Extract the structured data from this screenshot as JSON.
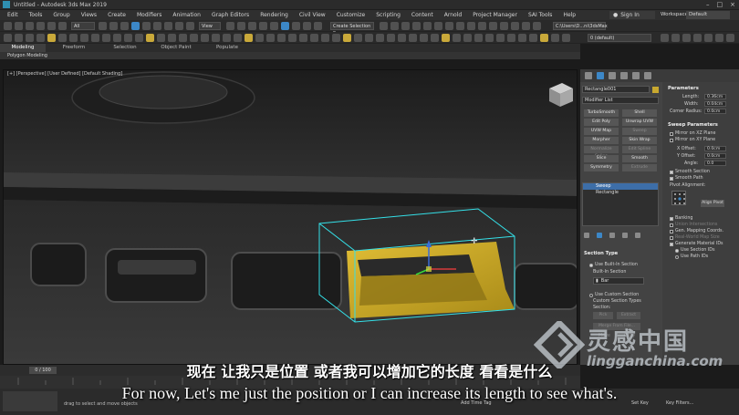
{
  "window": {
    "title": "Untitled - Autodesk 3ds Max 2019"
  },
  "menu": {
    "items": [
      "Edit",
      "Tools",
      "Group",
      "Views",
      "Create",
      "Modifiers",
      "Animation",
      "Graph Editors",
      "Rendering",
      "Civil View",
      "Customize",
      "Scripting",
      "Content",
      "Arnold",
      "Project Manager",
      "SAI Tools",
      "Help"
    ],
    "signin": "Sign In",
    "workspaces_label": "Workspaces:",
    "workspaces_value": "Default"
  },
  "toolbar": {
    "filter": "All",
    "view": "View",
    "selection_set": "Create Selection Se",
    "path": "C:\\Users\\D...ni\\3dsMax",
    "layer": "0 (default)"
  },
  "ribbon": {
    "tabs": [
      "Modeling",
      "Freeform",
      "Selection",
      "Object Paint",
      "Populate"
    ],
    "active": "Modeling",
    "subtitle": "Polygon Modeling"
  },
  "viewport": {
    "label": "[+] [Perspective] [User Defined] [Default Shading]"
  },
  "command_panel": {
    "object_name": "Rectangle001",
    "modifier_list": "Modifier List",
    "modifier_buttons": [
      {
        "label": "TurboSmooth",
        "dim": false
      },
      {
        "label": "Shell",
        "dim": false
      },
      {
        "label": "Edit Poly",
        "dim": false
      },
      {
        "label": "Unwrap UVW",
        "dim": false
      },
      {
        "label": "UVW Map",
        "dim": false
      },
      {
        "label": "Sweep",
        "dim": true
      },
      {
        "label": "Morpher",
        "dim": false
      },
      {
        "label": "Skin Wrap",
        "dim": false
      },
      {
        "label": "Normalize Spline",
        "dim": true
      },
      {
        "label": "Edit Spline",
        "dim": true
      },
      {
        "label": "Slice",
        "dim": false
      },
      {
        "label": "Smooth",
        "dim": false
      },
      {
        "label": "Symmetry",
        "dim": false
      },
      {
        "label": "Extrude",
        "dim": true
      }
    ],
    "stack": [
      "Sweep",
      "Rectangle"
    ],
    "section_type": {
      "header": "Section Type",
      "use_builtin": "Use Built-In Section",
      "builtin_label": "Built-In Section",
      "builtin_value": "Bar",
      "use_custom": "Use Custom Section",
      "custom_types": "Custom Section Types",
      "section_label": "Section:",
      "pick": "Pick",
      "extract": "Extract",
      "merge": "Merge From File...",
      "move": "Move",
      "copy": "Copy"
    },
    "parameters": {
      "header": "Parameters",
      "length_label": "Length:",
      "length_value": "0.36cm",
      "width_label": "Width:",
      "width_value": "0.04cm",
      "corner_label": "Corner Radius:",
      "corner_value": "0.0cm"
    },
    "sweep_params": {
      "header": "Sweep Parameters",
      "mirror_xz": "Mirror on XZ Plane",
      "mirror_xy": "Mirror on XY Plane",
      "xoffset_label": "X Offset:",
      "xoffset_value": "0.0cm",
      "yoffset_label": "Y Offset:",
      "yoffset_value": "0.0cm",
      "angle_label": "Angle:",
      "angle_value": "0.0",
      "smooth_section": "Smooth Section",
      "smooth_path": "Smooth Path",
      "pivot_alignment": "Pivot Alignment:",
      "align_pivot": "Align Pivot",
      "banking": "Banking",
      "union": "Union Intersections",
      "gen_mapping": "Gen. Mapping Coords.",
      "real_world": "Real-World Map Size",
      "gen_material": "Generate Material IDs",
      "use_section_ids": "Use Section IDs",
      "use_path_ids": "Use Path IDs"
    }
  },
  "timeline": {
    "frame": "0 / 100"
  },
  "status": {
    "prompt": "drag to select and move objects",
    "add_time_tag": "Add Time Tag",
    "set_key": "Set Key",
    "key_filters": "Key Filters..."
  },
  "subtitles": {
    "cn": "现在 让我只是位置 或者我可以增加它的长度 看看是什么",
    "en": "For now, Let's me just the position or I can increase its length to see what's."
  },
  "watermark": {
    "cn": "灵感中国",
    "url": "lingganchina.com"
  },
  "colors": {
    "accent": "#3c87c7",
    "object_yellow": "#c9a623",
    "selection_cyan": "#34e0e8"
  }
}
